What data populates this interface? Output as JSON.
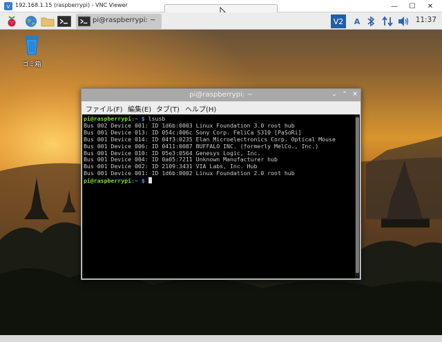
{
  "vnc_window": {
    "title": "192.168.1.15 (raspberrypi) - VNC Viewer",
    "minimize_glyph": "—",
    "maximize_glyph": "☐",
    "close_glyph": "✕"
  },
  "taskbar": {
    "task_label": "pi@raspberrypi: ~",
    "clock": "11:37",
    "tray_text": "A",
    "icons": [
      "raspberry-icon",
      "globe-icon",
      "folder-icon",
      "terminal-icon",
      "vnc-icon",
      "bluetooth-icon",
      "network-icon",
      "volume-icon"
    ]
  },
  "desktop": {
    "trash_label": "ゴミ箱"
  },
  "terminal": {
    "title": "pi@raspberrypi: ~",
    "menus": [
      "ファイル(F)",
      "編集(E)",
      "タブ(T)",
      "ヘルプ(H)"
    ],
    "prompt_user": "pi@raspberrypi",
    "prompt_path": ":~ $",
    "command": "lsusb",
    "output": [
      "Bus 002 Device 001: ID 1d6b:0003 Linux Foundation 3.0 root hub",
      "Bus 001 Device 013: ID 054c:006c Sony Corp. FeliCa S310 [PaSoRi]",
      "Bus 001 Device 014: ID 04f3:0235 Elan Microelectronics Corp. Optical Mouse",
      "Bus 001 Device 006: ID 0411:0087 BUFFALO INC. (formerly MelCo., Inc.)",
      "Bus 001 Device 010: ID 05e3:0564 Genesys Logic, Inc.",
      "Bus 001 Device 004: ID 0a05:7211 Unknown Manufacturer hub",
      "Bus 001 Device 002: ID 2109:3431 VIA Labs, Inc. Hub",
      "Bus 001 Device 001: ID 1d6b:0002 Linux Foundation 2.0 root hub"
    ],
    "close_glyph": "✕",
    "minimize_glyph": "⌄",
    "maximize_glyph": "⌃"
  },
  "colors": {
    "prompt_user": "#7fdc34",
    "prompt_path": "#5e8ef2",
    "terminal_bg": "#000000",
    "taskbar_bg": "#ececec"
  }
}
